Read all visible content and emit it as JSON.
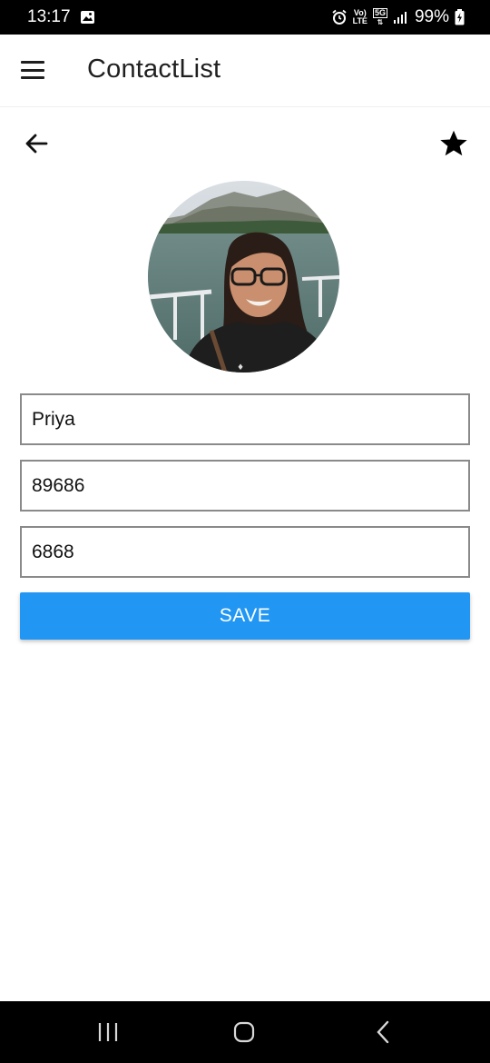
{
  "status_bar": {
    "time": "13:17",
    "vol_line1": "Vo)",
    "vol_line2": "LTE",
    "net_line1": "5G",
    "battery_percent": "99%"
  },
  "app_bar": {
    "title": "ContactList"
  },
  "form": {
    "name_value": "Priya",
    "phone_value": "89686",
    "other_value": "6868",
    "save_label": "SAVE"
  },
  "colors": {
    "accent": "#2196f3",
    "field_border": "#8a8a8a"
  },
  "icons": {
    "menu": "menu-icon",
    "back": "arrow-left-icon",
    "favorite": "star-icon",
    "nav_recents": "recents-icon",
    "nav_home": "home-icon",
    "nav_back": "chevron-left-icon"
  }
}
